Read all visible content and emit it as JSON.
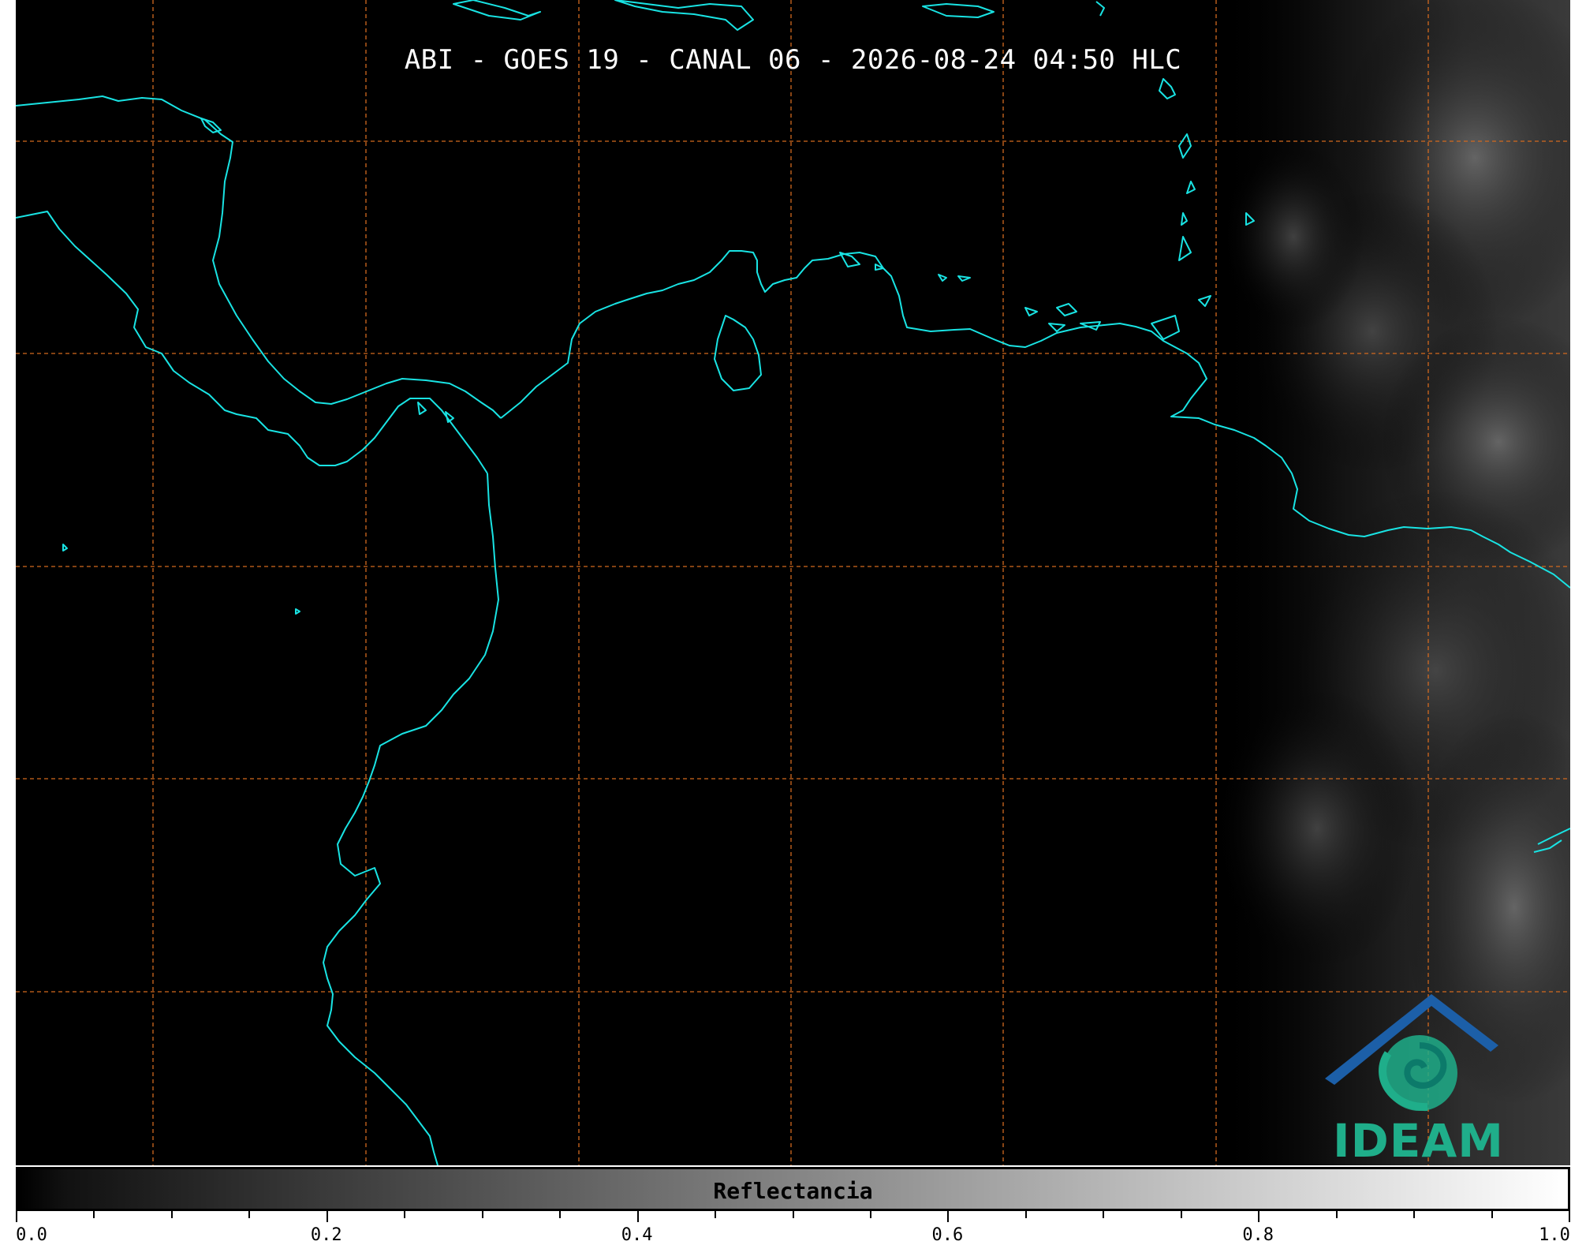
{
  "map": {
    "title": "ABI - GOES 19 - CANAL 06 - 2026-08-24 04:50 HLC",
    "coastline_color": "#19e3e3",
    "grid_color": "#d2691e",
    "background": "#000000",
    "cloud_shading": "gray"
  },
  "logo": {
    "text": "IDEAM",
    "icon": "ideam-logo-icon",
    "colors": [
      "#1c5fa8",
      "#1fae8a"
    ]
  },
  "colorbar": {
    "label": "Reflectancia",
    "min": 0.0,
    "max": 1.0,
    "tick_labels": [
      "0.0",
      "0.2",
      "0.4",
      "0.6",
      "0.8",
      "1.0"
    ],
    "colormap": "gray"
  }
}
